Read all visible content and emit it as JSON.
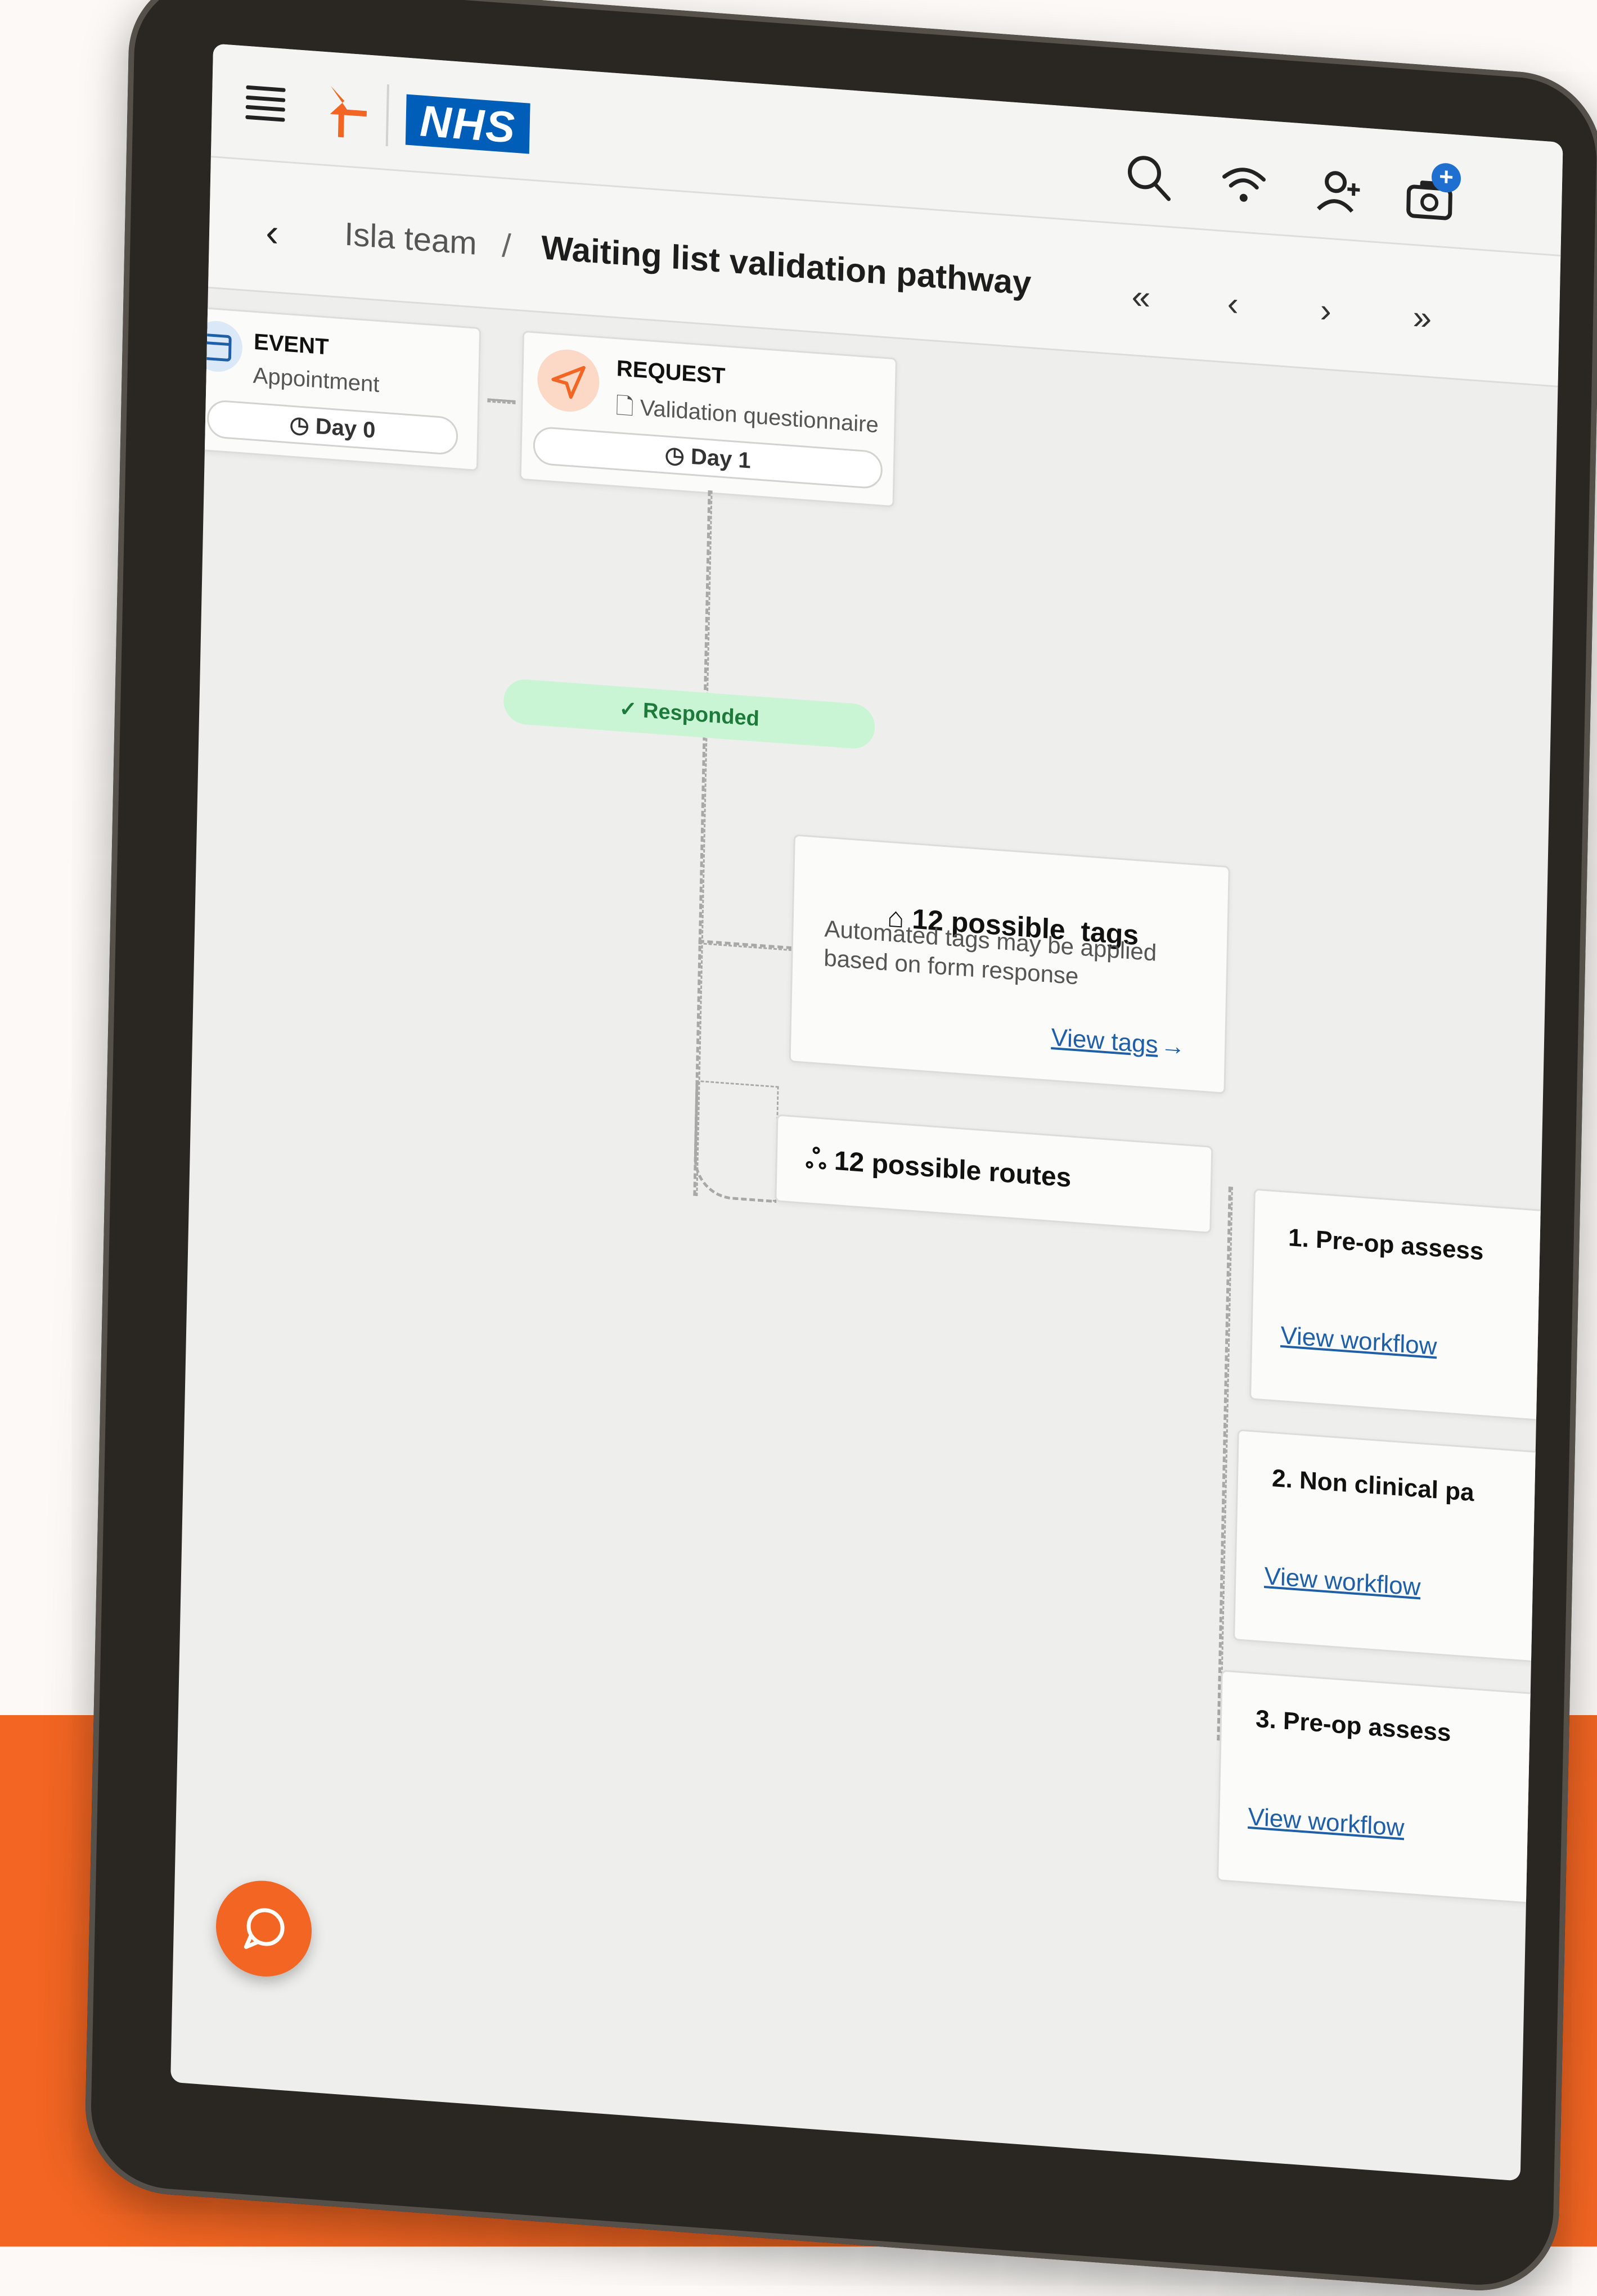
{
  "header": {
    "logo_text": "NHS"
  },
  "breadcrumb": {
    "parent": "Isla team",
    "separator": "/",
    "current": "Waiting list validation pathway"
  },
  "nav_controls": {
    "first": "«",
    "prev": "‹",
    "next": "›",
    "last": "»"
  },
  "notification_badge": "+",
  "nodes": {
    "event": {
      "type": "EVENT",
      "name": "Appointment",
      "day": "Day 0"
    },
    "request": {
      "type": "REQUEST",
      "name": "Validation questionnaire",
      "day": "Day 1"
    }
  },
  "responded_label": "✓ Responded",
  "tags_card": {
    "title": "12 possible  tags",
    "description": "Automated tags may be applied based on form response",
    "link": "View tags"
  },
  "routes_card": {
    "title": "12 possible routes"
  },
  "routes": [
    {
      "title": "1. Pre-op assess",
      "link": "View workflow"
    },
    {
      "title": "2. Non clinical pa",
      "link": "View workflow"
    },
    {
      "title": "3. Pre-op assess",
      "link": "View workflow"
    }
  ],
  "colors": {
    "accent_orange": "#f26522",
    "nhs_blue": "#005eb8",
    "link_blue": "#1e5fa8",
    "responded_green": "#c9f5d4"
  }
}
